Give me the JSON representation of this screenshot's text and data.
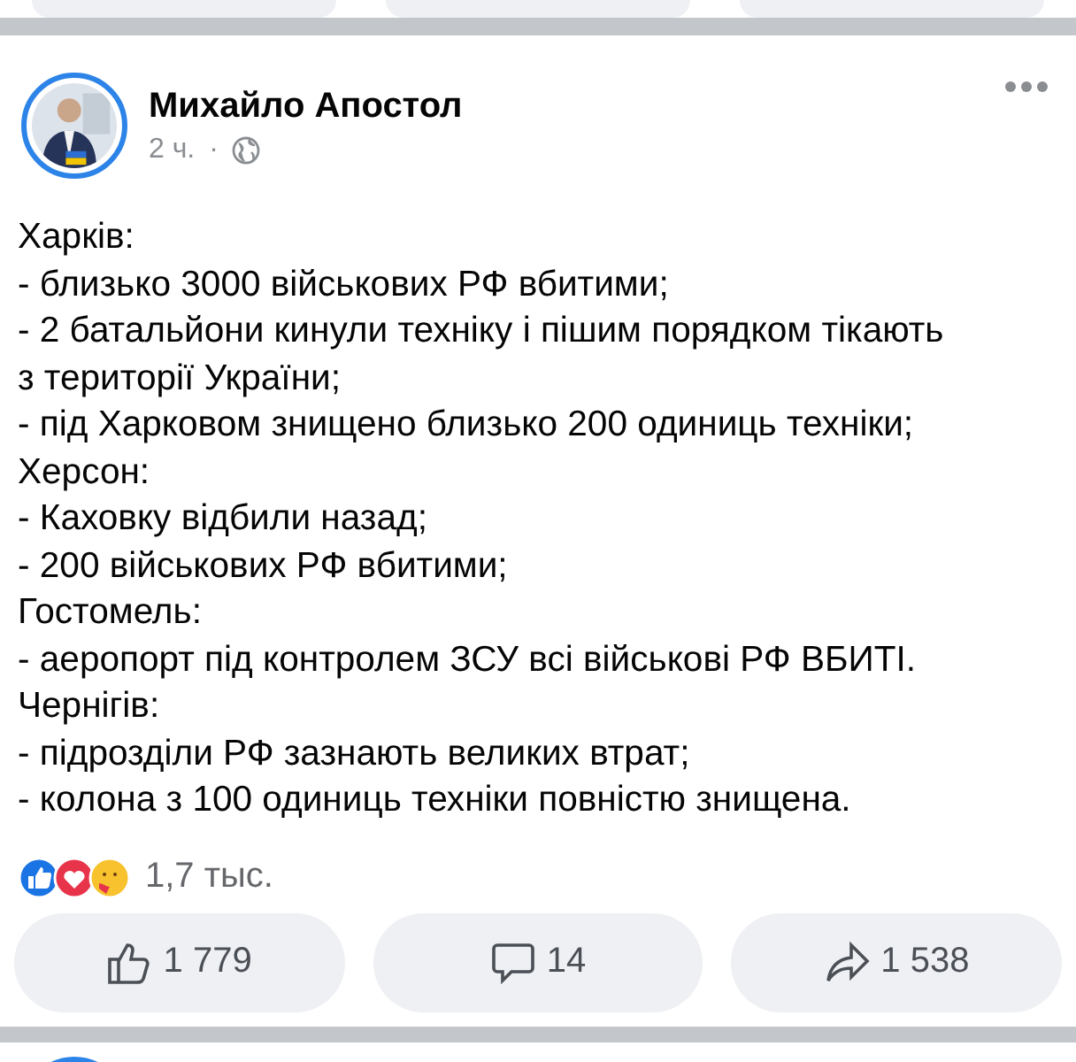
{
  "post": {
    "author": "Михайло Апостол",
    "time": "2 ч.",
    "separator": "·",
    "lines": [
      "Харків:",
      "- близько 3000 військових РФ вбитими;",
      "- 2 батальйони кинули техніку і пішим порядком тікають з території України;",
      "- під Харковом знищено близько 200 одиниць техніки;",
      "Херсон:",
      "- Каховку відбили назад;",
      "- 200 військових РФ вбитими;",
      "Гостомель:",
      "- аеропорт під контролем ЗСУ всі військові РФ ВБИТІ.",
      "Чернігів:",
      "- підрозділи РФ зазнають великих втрат;",
      "- колона з 100 одиниць техніки повністю знищена."
    ],
    "reactions": {
      "count": "1,7 тыс."
    },
    "actions": [
      {
        "kind": "like",
        "label": "1 779"
      },
      {
        "kind": "comment",
        "label": "14"
      },
      {
        "kind": "share",
        "label": "1 538"
      }
    ]
  }
}
